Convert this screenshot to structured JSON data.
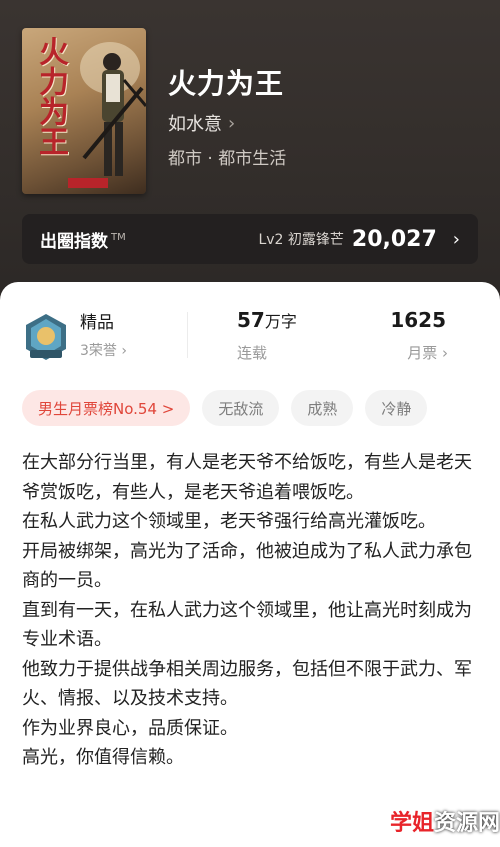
{
  "book": {
    "title": "火力为王",
    "cover_title": "火力为王",
    "author": "如水意",
    "author_chevron": "›",
    "genre": "都市 · 都市生活"
  },
  "index": {
    "label": "出圈指数",
    "tm": "TM",
    "level": "Lv2 初露锋芒",
    "value": "20,027",
    "chevron": "›"
  },
  "stats": {
    "quality": "精品",
    "honors": "3荣誉",
    "honors_chevron": "›",
    "words": "57",
    "words_unit": "万字",
    "status": "连载",
    "tickets": "1625",
    "tickets_label": "月票",
    "tickets_chevron": "›"
  },
  "tags": [
    "男生月票榜No.54 >",
    "无敌流",
    "成熟",
    "冷静"
  ],
  "description": [
    "在大部分行当里，有人是老天爷不给饭吃，有些人是老天爷赏饭吃，有些人，是老天爷追着喂饭吃。",
    "在私人武力这个领域里，老天爷强行给高光灌饭吃。",
    "开局被绑架，高光为了活命，他被迫成为了私人武力承包商的一员。",
    "直到有一天，在私人武力这个领域里，他让高光时刻成为专业术语。",
    "他致力于提供战争相关周边服务，包括但不限于武力、军火、情报、以及技术支持。",
    "作为业界良心，品质保证。",
    "高光，你值得信赖。"
  ],
  "watermark": {
    "highlight": "学姐",
    "rest": "资源网"
  },
  "colors": {
    "rank_tag_text": "#e0463a",
    "rank_tag_bg": "#fde7e5",
    "hero_bg": "#332e2b"
  }
}
